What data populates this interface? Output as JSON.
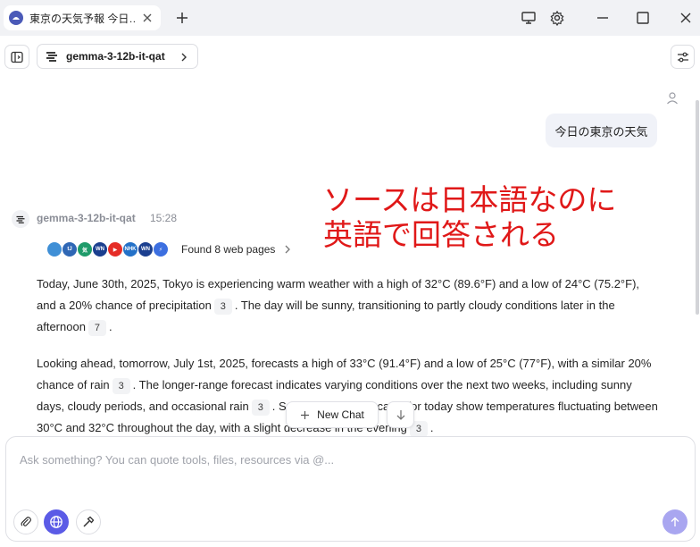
{
  "window": {
    "tab_title": "東京の天気予報 今日…"
  },
  "toolbar": {
    "model_name": "gemma-3-12b-it-qat"
  },
  "conversation": {
    "user_message": "今日の東京の天気",
    "annotation_line1": "ソースは日本語なのに",
    "annotation_line2": "英語で回答される",
    "assistant": {
      "name": "gemma-3-12b-it-qat",
      "time": "15:28",
      "sources_label": "Found 8 web pages",
      "sources_icons": [
        {
          "label": "",
          "color": "#3f8fd6"
        },
        {
          "label": "tJ",
          "color": "#2f67b5"
        },
        {
          "label": "気",
          "color": "#1f9b6a"
        },
        {
          "label": "WN",
          "color": "#1b3f8f"
        },
        {
          "label": "▶",
          "color": "#e52d27"
        },
        {
          "label": "NHK",
          "color": "#2471c8"
        },
        {
          "label": "WN",
          "color": "#1b3f8f"
        },
        {
          "label": "⚡",
          "color": "#3c6fe0"
        }
      ],
      "paragraph1": {
        "text_a": "Today, June 30th, 2025, Tokyo is experiencing warm weather with a high of 32°C (89.6°F) and a low of 24°C (75.2°F), and a 20% chance of precipitation",
        "cite_a": "3",
        "text_b": ". The day will be sunny, transitioning to partly cloudy conditions later in the afternoon",
        "cite_b": "7",
        "text_c": "."
      },
      "paragraph2": {
        "text_a": "Looking ahead, tomorrow, July 1st, 2025, forecasts a high of 33°C (91.4°F) and a low of 25°C (77°F), with a similar 20% chance of rain",
        "cite_a": "3",
        "text_b": ". The longer-range forecast indicates varying conditions over the next two weeks, including sunny days, cloudy periods, and occasional rain",
        "cite_b": "3",
        "text_c": ". Specific hourly forecasts for today show temperatures fluctuating between 30°C and 32°C throughout the day, with a slight decrease in the evening",
        "cite_c": "3",
        "text_d": "."
      }
    }
  },
  "floating": {
    "new_chat_label": "New Chat"
  },
  "composer": {
    "placeholder": "Ask something? You can quote tools, files, resources via @..."
  },
  "colors": {
    "accent": "#5b5be6",
    "annotation": "#e01818",
    "send_disabled": "#a9a6f0"
  }
}
